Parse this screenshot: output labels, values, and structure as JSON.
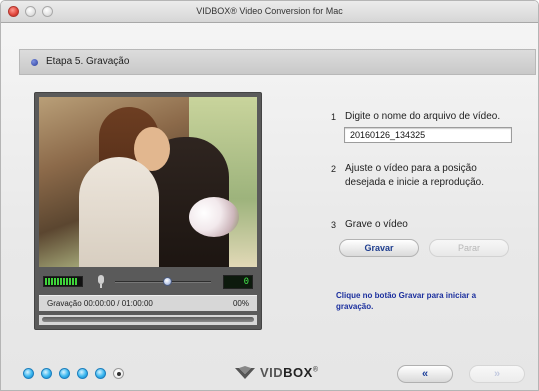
{
  "window": {
    "title": "VIDBOX® Video Conversion for Mac"
  },
  "step": {
    "label": "Etapa 5. Gravação"
  },
  "instructions": [
    {
      "num": "1",
      "text": "Digite o nome do arquivo de vídeo."
    },
    {
      "num": "2",
      "text_line1": "Ajuste o vídeo para a posição",
      "text_line2": "desejada e inicie a reprodução."
    },
    {
      "num": "3",
      "text": "Grave o vídeo"
    }
  ],
  "filename": {
    "value": "20160126_134325"
  },
  "buttons": {
    "record": "Gravar",
    "stop": "Parar"
  },
  "hint": {
    "line1": "Clique no botão Gravar para iniciar a",
    "line2": "gravação."
  },
  "player": {
    "counter": "0",
    "recording_time": "Gravação 00:00:00 / 01:00:00",
    "percent": "00%",
    "audio_level": 0.9,
    "volume_level": 0.55
  },
  "footer": {
    "logo_text_a": "VID",
    "logo_text_b": "BOX",
    "logo_mark": "®",
    "back_label": "«",
    "next_label": "»",
    "steps_total": 6,
    "current_step": 6
  },
  "colors": {
    "accent": "#1b2f9e",
    "meter": "#3fd43a",
    "step_dot": "#38b6ef"
  }
}
